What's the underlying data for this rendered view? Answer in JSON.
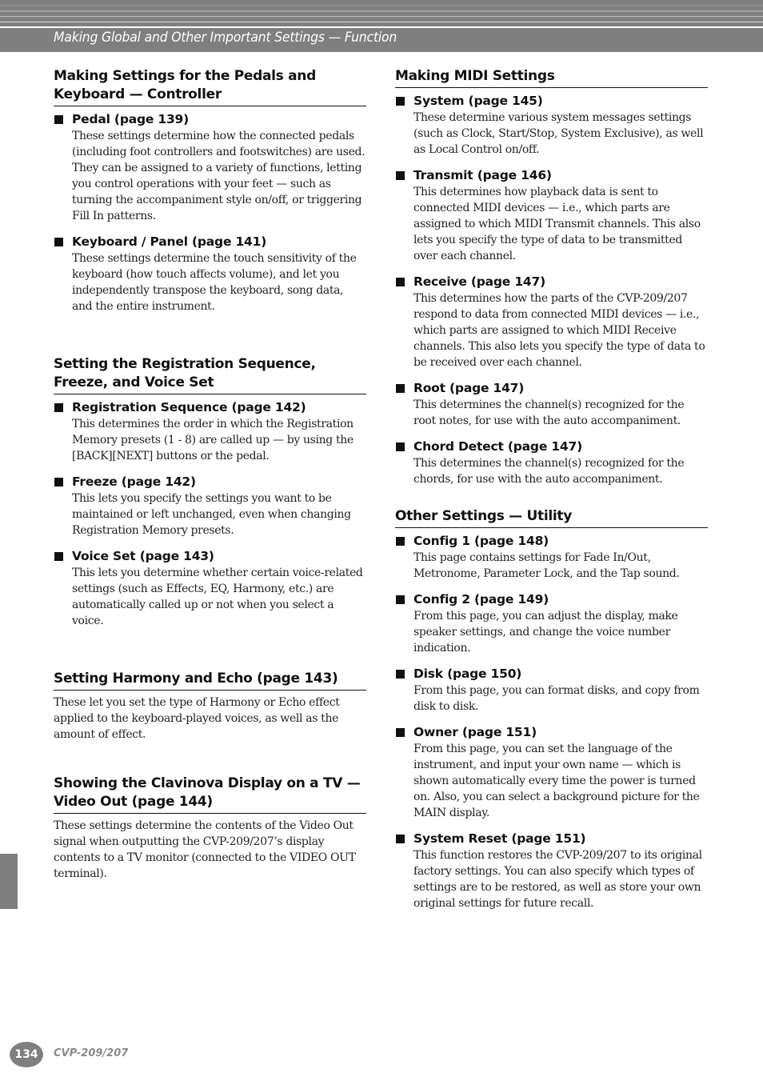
{
  "header": {
    "title": "Making Global and Other Important Settings — Function"
  },
  "left_column": {
    "sections": [
      {
        "title": "Making Settings for the Pedals and Keyboard — Controller",
        "items": [
          {
            "heading": "Pedal (page 139)",
            "body": "These settings determine how the connected pedals (including foot controllers and footswitches) are used. They can be assigned to a variety of functions, letting you control operations with your feet — such as turning the accompaniment style on/off, or triggering Fill In patterns."
          },
          {
            "heading": "Keyboard / Panel (page 141)",
            "body": "These settings determine the touch sensitivity of the keyboard (how touch affects volume), and let you independently transpose the keyboard, song data, and the entire instrument."
          }
        ]
      },
      {
        "title": "Setting the Registration Sequence, Freeze, and Voice Set",
        "items": [
          {
            "heading": "Registration Sequence (page 142)",
            "body": "This determines the order in which the Registration Memory presets (1 - 8) are called up — by using the [BACK][NEXT] buttons or the pedal."
          },
          {
            "heading": "Freeze (page 142)",
            "body": "This lets you specify the settings you want to be maintained or left unchanged, even when changing Registration Memory presets."
          },
          {
            "heading": "Voice Set (page 143)",
            "body": "This lets you determine whether certain voice-related settings (such as Effects, EQ, Harmony, etc.) are automatically called up or not when you select a voice."
          }
        ]
      },
      {
        "title": "Setting Harmony and Echo (page 143)",
        "body": "These let you set the type of Harmony or Echo effect applied to the keyboard-played voices, as well as the amount of effect."
      },
      {
        "title": "Showing the Clavinova Display on a TV — Video Out (page 144)",
        "body": "These settings determine the contents of the Video Out signal when outputting the CVP-209/207’s display contents to a TV monitor (connected to the VIDEO OUT terminal)."
      }
    ]
  },
  "right_column": {
    "sections": [
      {
        "title": "Making MIDI Settings",
        "items": [
          {
            "heading": "System (page 145)",
            "body": "These determine various system messages settings (such as Clock, Start/Stop, System Exclusive), as well as Local Control on/off."
          },
          {
            "heading": "Transmit (page 146)",
            "body": "This determines how playback data is sent to connected MIDI devices — i.e., which parts are assigned to which MIDI Transmit channels. This also lets you specify the type of data to be transmitted over each channel."
          },
          {
            "heading": "Receive (page 147)",
            "body": "This determines how the parts of the CVP-209/207 respond to data from connected MIDI devices — i.e., which parts are assigned to which MIDI Receive channels. This also lets you specify the type of data to be received over each channel."
          },
          {
            "heading": "Root (page 147)",
            "body": "This determines the channel(s) recognized for the root notes, for use with the auto accompaniment."
          },
          {
            "heading": "Chord Detect (page 147)",
            "body": "This determines the channel(s) recognized for the chords, for use with the auto accompaniment."
          }
        ]
      },
      {
        "title": "Other Settings — Utility",
        "items": [
          {
            "heading": "Config 1 (page 148)",
            "body": "This page contains settings for Fade In/Out, Metronome, Parameter Lock, and the Tap sound."
          },
          {
            "heading": "Config 2 (page 149)",
            "body": "From this page, you can adjust the display, make speaker settings, and change the voice number indication."
          },
          {
            "heading": "Disk (page 150)",
            "body": "From this page, you can format disks, and copy from disk to disk."
          },
          {
            "heading": "Owner (page 151)",
            "body": "From this page, you can set the language of the instrument, and input your own name — which is shown automatically every time the power is turned on. Also, you can select a background picture for the MAIN display."
          },
          {
            "heading": "System Reset (page 151)",
            "body": "This function restores the CVP-209/207 to its original factory settings. You can also specify which types of settings are to be restored, as well as store your own original settings for future recall."
          }
        ]
      }
    ]
  },
  "footer": {
    "page_number": "134",
    "model": "CVP-209/207"
  },
  "colors": {
    "header_gray": "#7f7f7f",
    "text": "#1a1a1a",
    "footer_model": "#8a8a8a"
  }
}
